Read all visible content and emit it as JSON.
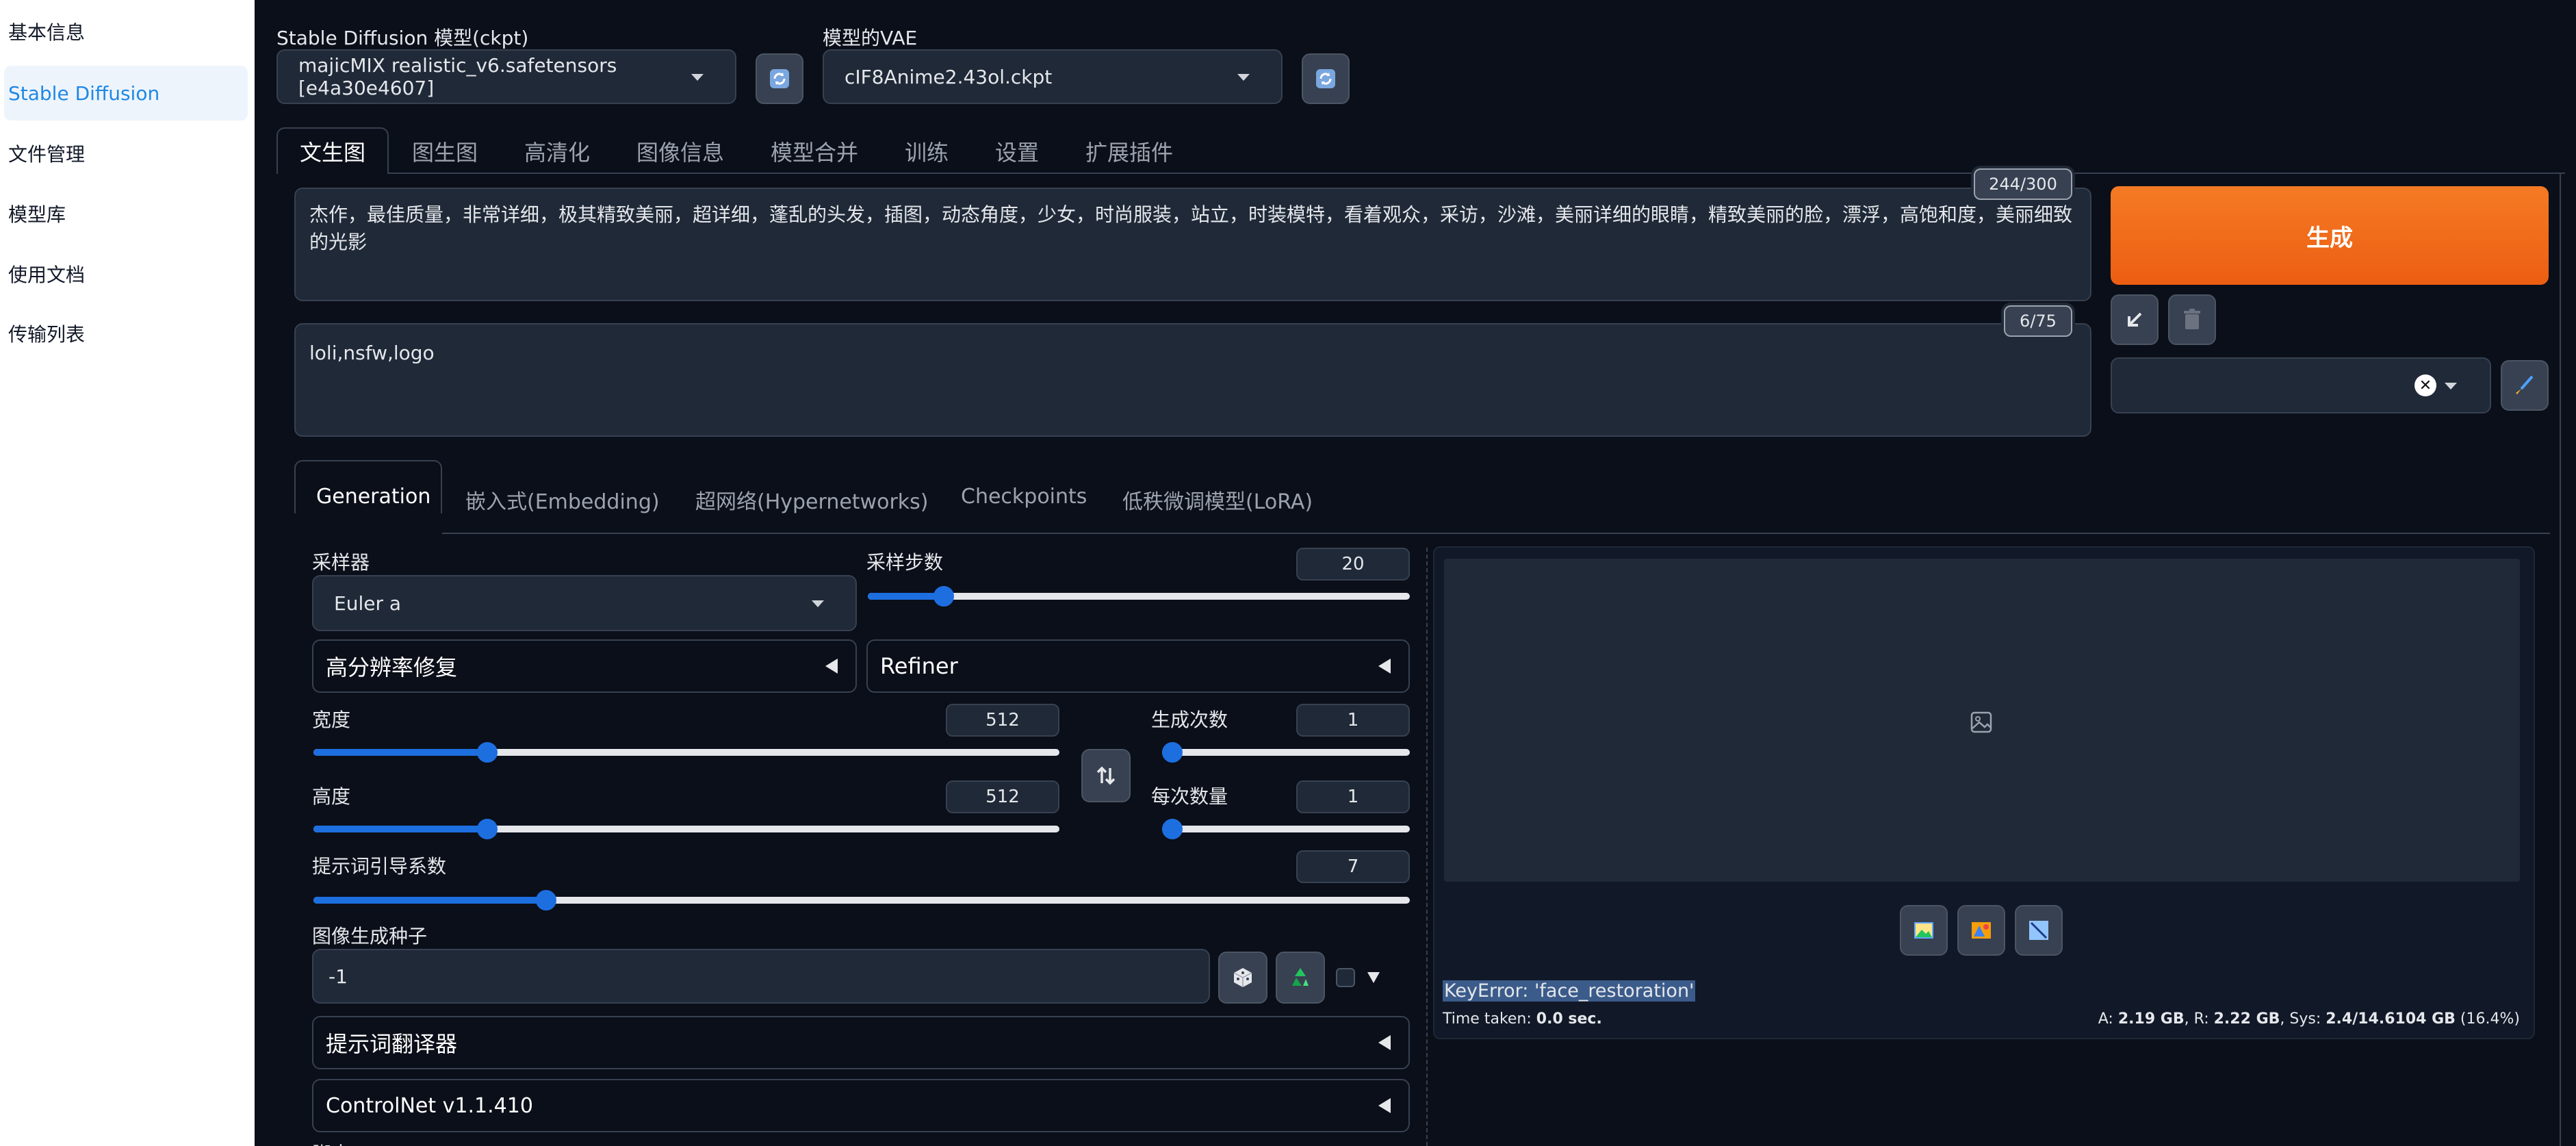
{
  "sidebar": {
    "items": [
      {
        "label": "基本信息",
        "active": false
      },
      {
        "label": "Stable Diffusion",
        "active": true
      },
      {
        "label": "文件管理",
        "active": false
      },
      {
        "label": "模型库",
        "active": false
      },
      {
        "label": "使用文档",
        "active": false
      },
      {
        "label": "传输列表",
        "active": false
      }
    ]
  },
  "model": {
    "ckpt_label": "Stable Diffusion 模型(ckpt)",
    "ckpt_value": "majicMIX realistic_v6.safetensors [e4a30e4607]",
    "vae_label": "模型的VAE",
    "vae_value": "cIF8Anime2.43ol.ckpt"
  },
  "main_tabs": [
    "文生图",
    "图生图",
    "高清化",
    "图像信息",
    "模型合并",
    "训练",
    "设置",
    "扩展插件"
  ],
  "prompt": {
    "text": "杰作，最佳质量，非常详细，极其精致美丽，超详细，蓬乱的头发，插图，动态角度，少女，时尚服装，站立，时装模特，看着观众，采访，沙滩，美丽详细的眼睛，精致美丽的脸，漂浮，高饱和度，美丽细致的光影",
    "counter": "244/300"
  },
  "negative_prompt": {
    "text": "loli,nsfw,logo",
    "counter": "6/75"
  },
  "generate_label": "生成",
  "sub_tabs": [
    "Generation",
    "嵌入式(Embedding)",
    "超网络(Hypernetworks)",
    "Checkpoints",
    "低秩微调模型(LoRA)"
  ],
  "settings": {
    "sampler_label": "采样器",
    "sampler_value": "Euler a",
    "steps_label": "采样步数",
    "steps_value": "20",
    "steps_fraction": 0.14,
    "hires_label": "高分辨率修复",
    "refiner_label": "Refiner",
    "width_label": "宽度",
    "width_value": "512",
    "width_fraction": 0.233,
    "height_label": "高度",
    "height_value": "512",
    "height_fraction": 0.233,
    "batch_count_label": "生成次数",
    "batch_count_value": "1",
    "batch_count_fraction": 0.0,
    "batch_size_label": "每次数量",
    "batch_size_value": "1",
    "batch_size_fraction": 0.0,
    "cfg_label": "提示词引导系数",
    "cfg_value": "7",
    "cfg_fraction": 0.212,
    "seed_label": "图像生成种子",
    "seed_value": "-1",
    "translator_label": "提示词翻译器",
    "controlnet_label": "ControlNet v1.1.410",
    "more_label": "脚本"
  },
  "output": {
    "error": "KeyError: 'face_restoration'",
    "time_label": "Time taken: ",
    "time_value": "0.0 sec.",
    "mem_a_label": "A: ",
    "mem_a": "2.19 GB",
    "mem_r_label": ", R: ",
    "mem_r": "2.22 GB",
    "mem_sys_label": ", Sys: ",
    "mem_sys": "2.4/14.6104 GB",
    "mem_pct": " (16.4%)"
  },
  "colors": {
    "accent": "#1d6fe0",
    "generate": "#f26b1d",
    "background": "#0b0f19"
  }
}
